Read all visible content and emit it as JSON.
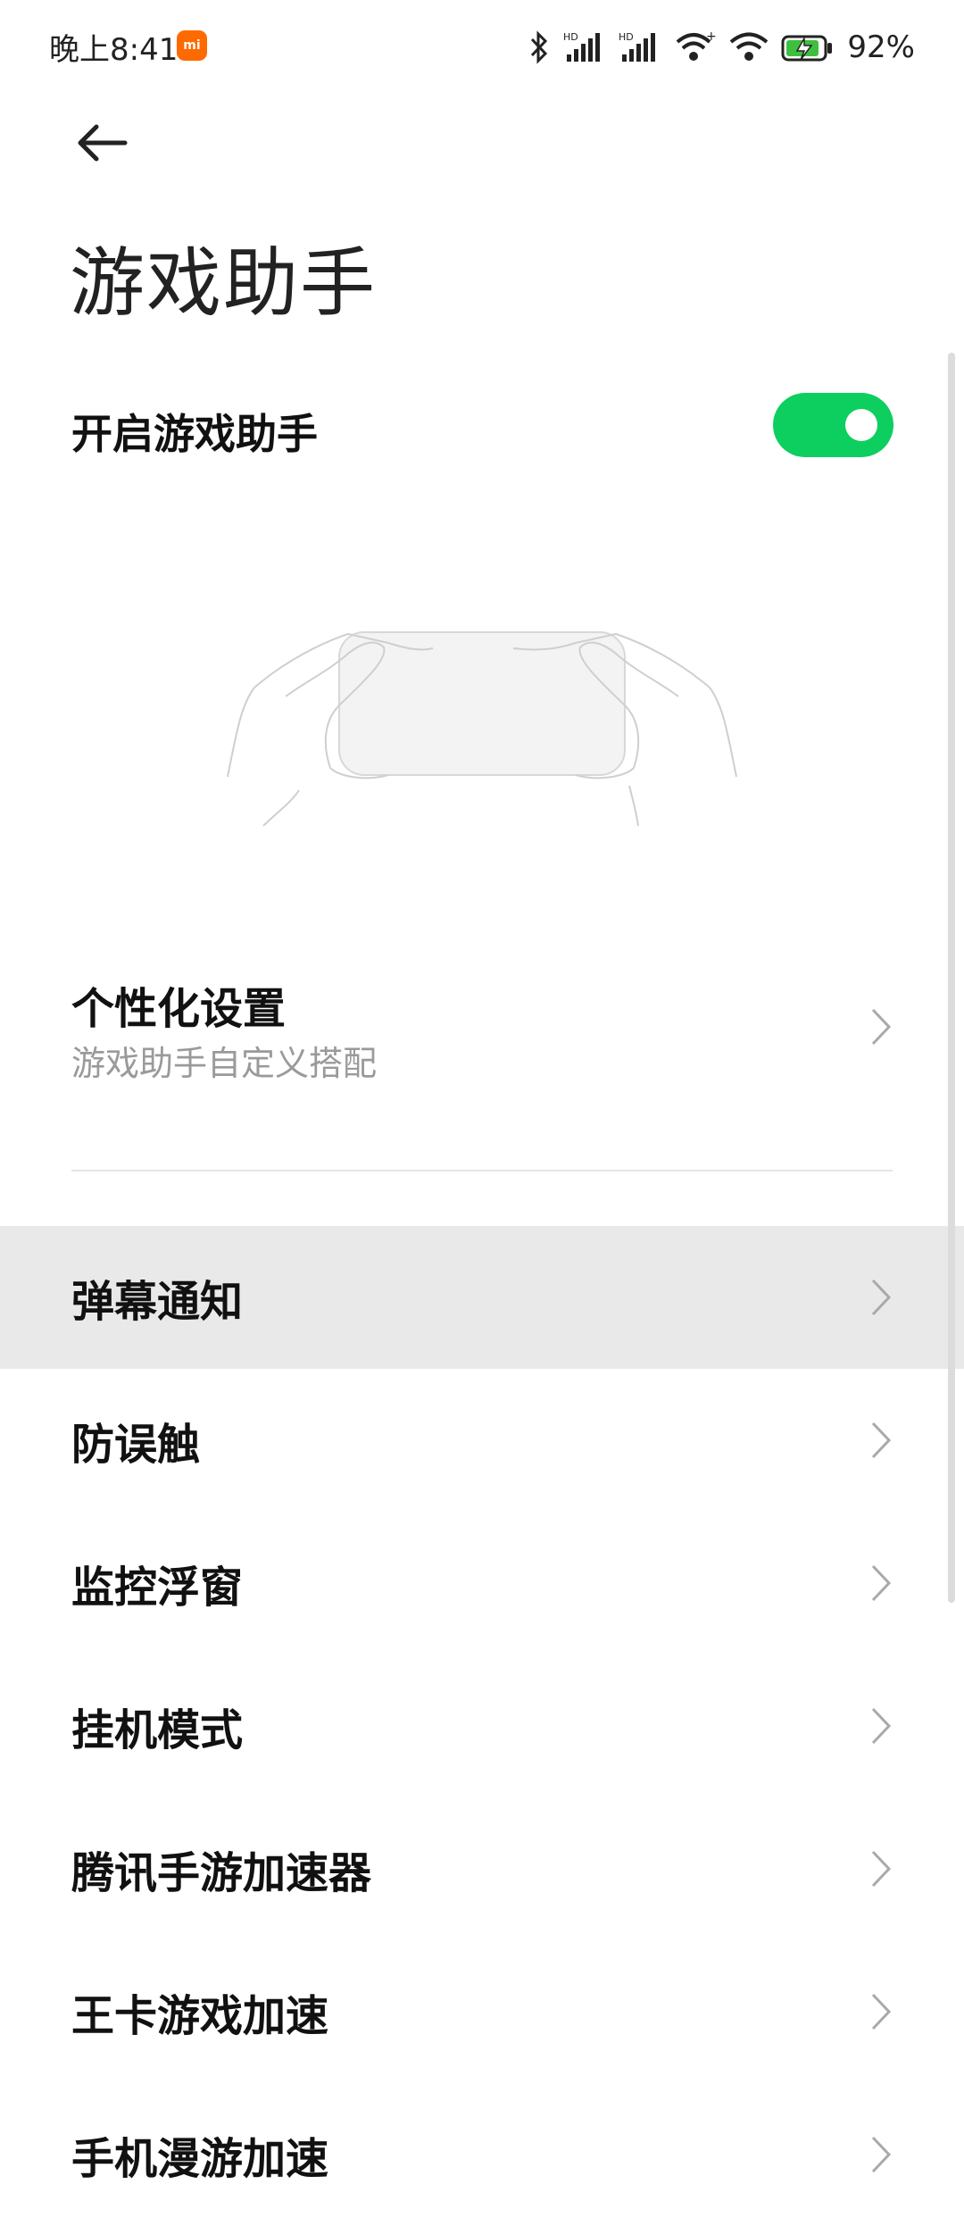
{
  "status_bar": {
    "time": "晚上8:41",
    "mi_badge": "mi",
    "battery_percent": "92%"
  },
  "header": {
    "back_icon": "arrow-left-icon",
    "title": "游戏助手"
  },
  "toggle": {
    "label": "开启游戏助手",
    "enabled": true,
    "accent_color": "#0ccf60"
  },
  "personalization": {
    "title": "个性化设置",
    "subtitle": "游戏助手自定义搭配"
  },
  "menu_items": [
    {
      "label": "弹幕通知",
      "active": true
    },
    {
      "label": "防误触"
    },
    {
      "label": "监控浮窗"
    },
    {
      "label": "挂机模式"
    },
    {
      "label": "腾讯手游加速器"
    },
    {
      "label": "王卡游戏加速"
    },
    {
      "label": "手机漫游加速"
    }
  ]
}
